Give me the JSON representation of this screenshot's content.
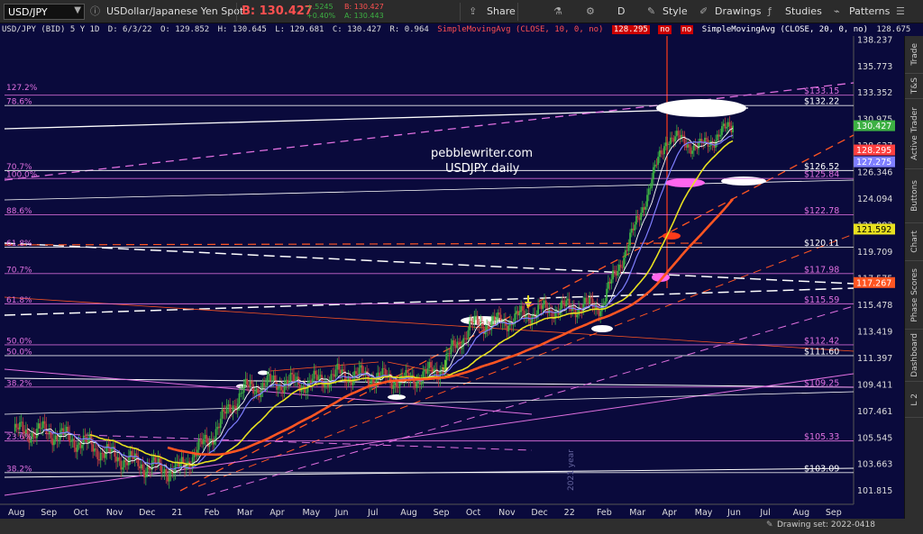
{
  "toolbar": {
    "symbol": "USD/JPY",
    "description": "USDollar/Japanese Yen Spot",
    "bid_label": "B: 130.427",
    "change_abs": "+.5245",
    "change_pct": "+0.40%",
    "bid_small": "B: 130.427",
    "ask_small": "A: 130.443",
    "share": "Share",
    "timeframe": "D",
    "style": "Style",
    "drawings": "Drawings",
    "studies": "Studies",
    "patterns": "Patterns"
  },
  "inforow": {
    "name": "USD/JPY (BID) 5 Y 1D",
    "date": "D: 6/3/22",
    "open": "O: 129.852",
    "high": "H: 130.645",
    "low": "L: 129.681",
    "close": "C: 130.427",
    "range": "R: 0.964",
    "sma10": "SimpleMovingAvg (CLOSE, 10, 0, no)",
    "sma10_val": "128.295",
    "sma20": "SimpleMovingAvg (CLOSE, 20, 0, no)",
    "sma20_val": "128.675",
    "no": "no"
  },
  "side_tabs": [
    "Trade",
    "T&S",
    "Active Trader",
    "Buttons",
    "Chart",
    "Phase Scores",
    "Dashboard",
    "L 2"
  ],
  "status": {
    "drawing_set": "Drawing set: 2022-0418"
  },
  "colors": {
    "background": "#0a0a3c",
    "fib": "#e070e0",
    "price_up": "#3cb043",
    "sma_white": "#ffffff",
    "sma_blue": "#7f7fff",
    "sma_yellow": "#e8e020",
    "sma_red": "#ff5522"
  },
  "chart_data": {
    "type": "candlestick",
    "title": "pebblewriter.com",
    "subtitle": "USDJPY daily",
    "watermark": "2021 year",
    "x_ticks": [
      "Aug",
      "Sep",
      "Oct",
      "Nov",
      "Dec",
      "21",
      "Feb",
      "Mar",
      "Apr",
      "May",
      "Jun",
      "Jul",
      "Aug",
      "Sep",
      "Oct",
      "Nov",
      "Dec",
      "22",
      "Feb",
      "Mar",
      "Apr",
      "May",
      "Jun",
      "Jul",
      "Aug",
      "Sep"
    ],
    "y_ticks": [
      101.815,
      103.663,
      105.545,
      107.461,
      109.411,
      111.397,
      113.419,
      115.478,
      117.575,
      119.709,
      121.883,
      124.094,
      126.346,
      128.637,
      130.975,
      133.352,
      135.773,
      138.237
    ],
    "ylim": [
      100.9,
      138.6
    ],
    "y_scale": "log",
    "close_path": [
      [
        "Aug",
        106.0
      ],
      [
        "Sep",
        106.0
      ],
      [
        "Oct",
        105.3
      ],
      [
        "Nov",
        104.3
      ],
      [
        "Dec",
        103.6
      ],
      [
        "21",
        103.2
      ],
      [
        "Feb",
        105.5
      ],
      [
        "Mar",
        109.0
      ],
      [
        "Apr",
        109.6
      ],
      [
        "May",
        109.5
      ],
      [
        "Jun",
        110.2
      ],
      [
        "Jul",
        110.0
      ],
      [
        "Aug",
        109.7
      ],
      [
        "Sep",
        110.5
      ],
      [
        "Oct",
        113.9
      ],
      [
        "Nov",
        114.2
      ],
      [
        "Dec",
        115.0
      ],
      [
        "22",
        115.3
      ],
      [
        "Feb",
        115.5
      ],
      [
        "Mar",
        121.6
      ],
      [
        "Apr",
        129.5
      ],
      [
        "May",
        128.5
      ],
      [
        "Jun",
        130.43
      ]
    ],
    "price_labels": [
      {
        "value": 130.427,
        "text": "130.427",
        "color": "#3cb043"
      },
      {
        "value": 128.295,
        "text": "128.295",
        "color": "#ff4040"
      },
      {
        "value": 127.275,
        "text": "127.275",
        "color": "#7f7fff"
      },
      {
        "value": 121.592,
        "text": "121.592",
        "color": "#e8e020"
      },
      {
        "value": 117.267,
        "text": "117.267",
        "color": "#ff5522"
      }
    ],
    "fib_left_labels": [
      {
        "text": "127.2%",
        "value": 133.5
      },
      {
        "text": "78.6%",
        "value": 132.22
      },
      {
        "text": "70.7%",
        "value": 126.52
      },
      {
        "text": "100.0%",
        "value": 125.84
      },
      {
        "text": "88.6%",
        "value": 122.78
      },
      {
        "text": "61.8%",
        "value": 120.11
      },
      {
        "text": "70.7%",
        "value": 117.98
      },
      {
        "text": "61.8%",
        "value": 115.59
      },
      {
        "text": "50.0%",
        "value": 112.42
      },
      {
        "text": "50.0%",
        "value": 111.6
      },
      {
        "text": "38.2%",
        "value": 109.25
      },
      {
        "text": "23.6%",
        "value": 105.33
      },
      {
        "text": "38.2%",
        "value": 103.09
      }
    ],
    "fib_right_labels": [
      {
        "text": "$133.15",
        "value": 133.15,
        "color": "#e070e0"
      },
      {
        "text": "$132.22",
        "value": 132.22,
        "color": "#ffffff"
      },
      {
        "text": "$126.52",
        "value": 126.52,
        "color": "#ffffff"
      },
      {
        "text": "$125.84",
        "value": 125.84,
        "color": "#e070e0"
      },
      {
        "text": "$122.78",
        "value": 122.78,
        "color": "#e070e0"
      },
      {
        "text": "$120.11",
        "value": 120.11,
        "color": "#ffffff"
      },
      {
        "text": "$117.98",
        "value": 117.98,
        "color": "#e070e0"
      },
      {
        "text": "$115.59",
        "value": 115.59,
        "color": "#e070e0"
      },
      {
        "text": "$112.42",
        "value": 112.42,
        "color": "#e070e0"
      },
      {
        "text": "$111.60",
        "value": 111.6,
        "color": "#ffffff"
      },
      {
        "text": "$109.25",
        "value": 109.25,
        "color": "#e070e0"
      },
      {
        "text": "$105.33",
        "value": 105.33,
        "color": "#e070e0"
      },
      {
        "text": "$103.09",
        "value": 103.09,
        "color": "#ffffff"
      }
    ]
  }
}
